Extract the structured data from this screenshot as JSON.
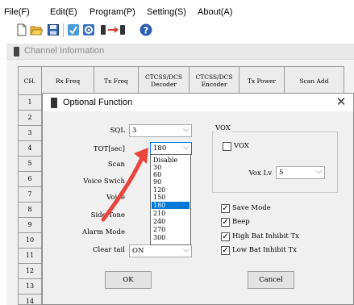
{
  "menu": {
    "items": [
      "File(F)",
      "Edit(E)",
      "Program(P)",
      "Setting(S)",
      "About(A)"
    ]
  },
  "toolbar": {
    "icons": [
      "new-file-icon",
      "open-folder-icon",
      "save-icon",
      "read-radio-icon",
      "settings-icon",
      "write-radio-icon",
      "help-icon"
    ]
  },
  "channel_window": {
    "title": "Channel Information",
    "columns": [
      "CH.",
      "Rx Freq",
      "Tx Freq",
      "CTCSS/DCS Decoder",
      "CTCSS/DCS Encoder",
      "Tx Power",
      "Scan Add"
    ],
    "rows": [
      "1",
      "2",
      "3",
      "4",
      "5",
      "6",
      "7",
      "8",
      "9",
      "10",
      "11",
      "12",
      "13",
      "14"
    ]
  },
  "dialog": {
    "title": "Optional Function",
    "close_glyph": "✕",
    "fields": {
      "sql": {
        "label": "SQL",
        "value": "3"
      },
      "tot": {
        "label": "TOT[sec]",
        "value": "180"
      },
      "scan": {
        "label": "Scan"
      },
      "voice_switch": {
        "label": "Voice Swich"
      },
      "voice": {
        "label": "Voice"
      },
      "side_tone": {
        "label": "Side Tone"
      },
      "alarm_mode": {
        "label": "Alarm Mode"
      },
      "clear_tail": {
        "label": "Clear tail",
        "value": "ON"
      }
    },
    "vox": {
      "legend": "VOX",
      "checkbox_label": "VOX",
      "checked": false,
      "level_label": "Vox Lv",
      "level_value": "5"
    },
    "options": [
      {
        "label": "Save Mode",
        "checked": true
      },
      {
        "label": "Beep",
        "checked": true
      },
      {
        "label": "High Bat Inhibit Tx",
        "checked": true
      },
      {
        "label": "Low Bat Inhibit Tx",
        "checked": true
      }
    ],
    "ok_label": "OK",
    "cancel_label": "Cancel",
    "tot_dropdown": {
      "options": [
        "Disable",
        "30",
        "60",
        "90",
        "120",
        "150",
        "180",
        "210",
        "240",
        "270",
        "300"
      ],
      "selected": "180"
    }
  },
  "colors": {
    "selection": "#0078d7",
    "annotation_arrow": "#e8453c"
  }
}
